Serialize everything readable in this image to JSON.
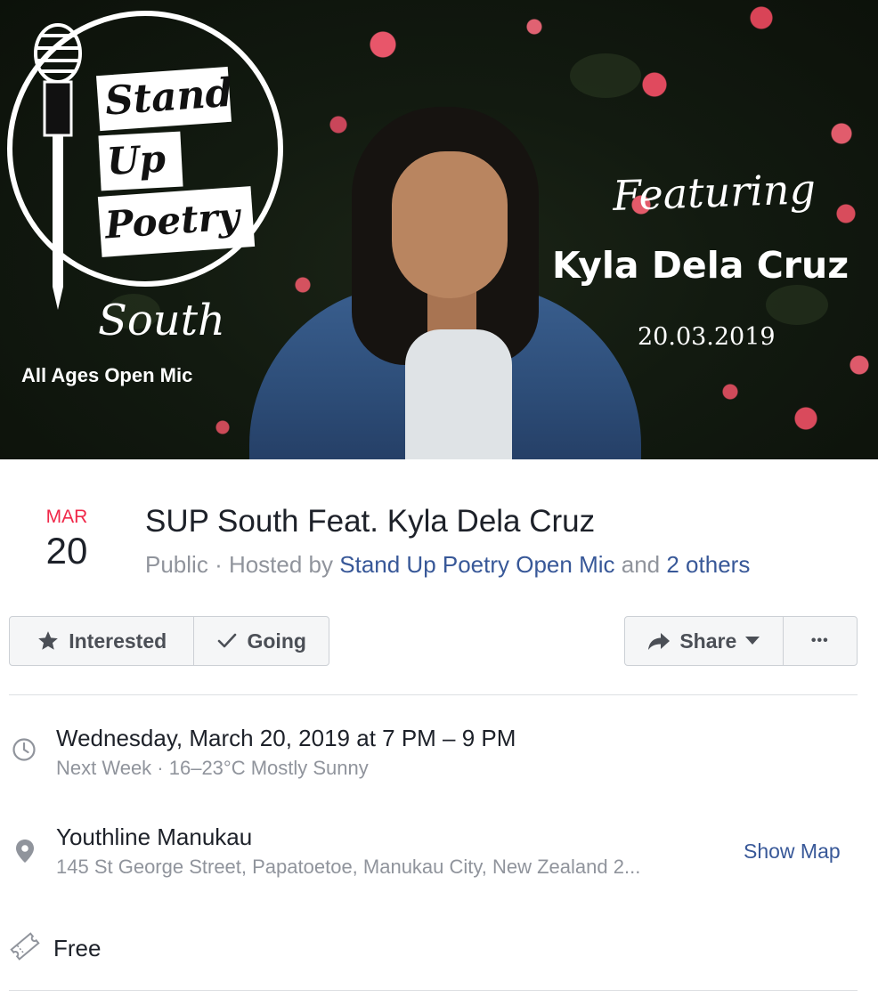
{
  "cover": {
    "logo_line1": "Stand",
    "logo_line2": "Up",
    "logo_line3": "Poetry",
    "logo_line4": "South",
    "logo_tagline": "All Ages Open Mic",
    "featuring_label": "Featuring",
    "featured_name": "Kyla Dela Cruz",
    "poster_date": "20.03.2019"
  },
  "event": {
    "month": "MAR",
    "day": "20",
    "title": "SUP South Feat. Kyla Dela Cruz",
    "privacy": "Public",
    "hosted_by_prefix": "· Hosted by",
    "host_link": "Stand Up Poetry Open Mic",
    "and_text": "and",
    "others_link": "2 others"
  },
  "actions": {
    "interested": "Interested",
    "going": "Going",
    "share": "Share",
    "more": "•••"
  },
  "details": {
    "datetime": "Wednesday, March 20, 2019 at 7 PM – 9 PM",
    "datetime_sub": "Next Week · 16–23°C Mostly Sunny",
    "venue": "Youthline Manukau",
    "address": "145 St George Street, Papatoetoe, Manukau City, New Zealand 2...",
    "show_map": "Show Map",
    "price": "Free"
  },
  "icons": {
    "time": "clock-icon",
    "location": "map-pin-icon",
    "ticket": "ticket-icon",
    "interested": "star-icon",
    "going": "checkmark-icon",
    "share": "share-arrow-icon",
    "share_dropdown": "caret-down-icon"
  },
  "colors": {
    "accent_link": "#385898",
    "date_red": "#f02849",
    "muted_text": "#90949c",
    "button_bg": "#f5f6f7"
  }
}
